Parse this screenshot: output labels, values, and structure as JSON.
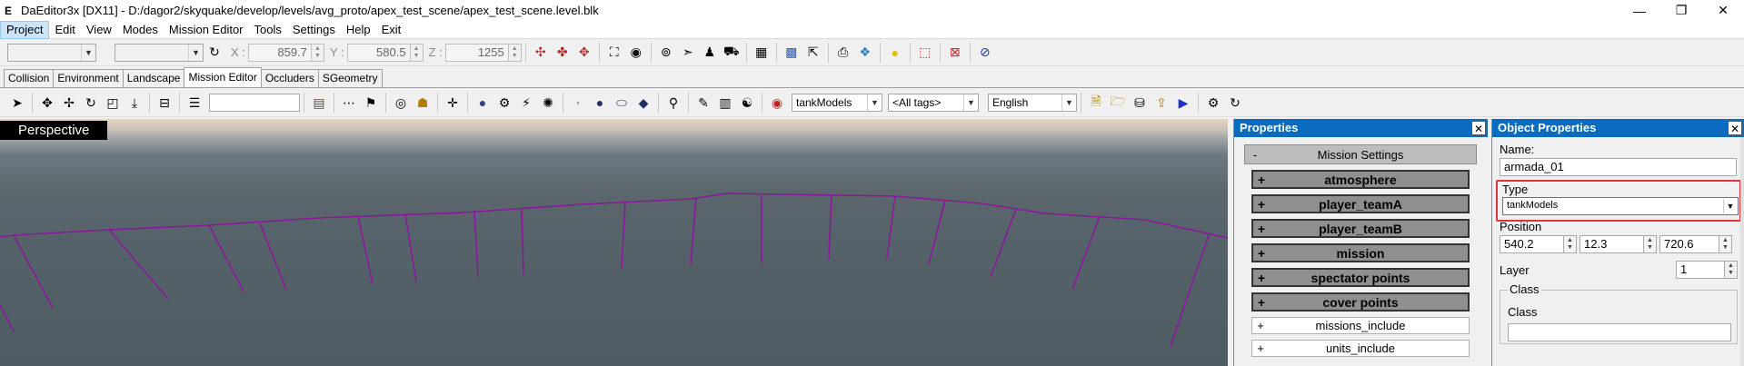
{
  "titlebar": {
    "app_icon": "E",
    "title": "DaEditor3x  [DX11]  -  D:/dagor2/skyquake/develop/levels/avg_proto/apex_test_scene/apex_test_scene.level.blk",
    "minimize": "—",
    "maximize": "❐",
    "close": "✕"
  },
  "menu": [
    "Project",
    "Edit",
    "View",
    "Modes",
    "Mission Editor",
    "Tools",
    "Settings",
    "Help",
    "Exit"
  ],
  "toolbar1": {
    "x_label": "X :",
    "x_value": "859.7",
    "y_label": "Y :",
    "y_value": "580.5",
    "z_label": "Z :",
    "z_value": "1255"
  },
  "tabs": [
    "Collision",
    "Environment",
    "Landscape",
    "Mission Editor",
    "Occluders",
    "SGeometry"
  ],
  "toolbar2": {
    "search_value": "",
    "model_select": "tankModels",
    "tags_select": "<All tags>",
    "language_select": "English"
  },
  "viewport": {
    "label": "Perspective"
  },
  "properties_panel": {
    "title": "Properties",
    "close": "✕",
    "section_toggle": "-",
    "section": "Mission Settings",
    "groups": [
      "atmosphere",
      "player_teamA",
      "player_teamB",
      "mission",
      "spectator points",
      "cover points"
    ],
    "plain_groups": [
      "missions_include",
      "units_include"
    ],
    "plus": "+"
  },
  "object_properties": {
    "title": "Object Properties",
    "close": "✕",
    "name_label": "Name:",
    "name_value": "armada_01",
    "type_label": "Type",
    "type_value": "tankModels",
    "position_label": "Position",
    "pos_x": "540.2",
    "pos_y": "12.3",
    "pos_z": "720.6",
    "layer_label": "Layer",
    "layer_value": "1",
    "class_group_label": "Class",
    "class_label": "Class"
  },
  "colors": {
    "panel_header": "#0a6cc1",
    "highlight_box": "#d9363e",
    "track_line": "#8a1a9a"
  }
}
